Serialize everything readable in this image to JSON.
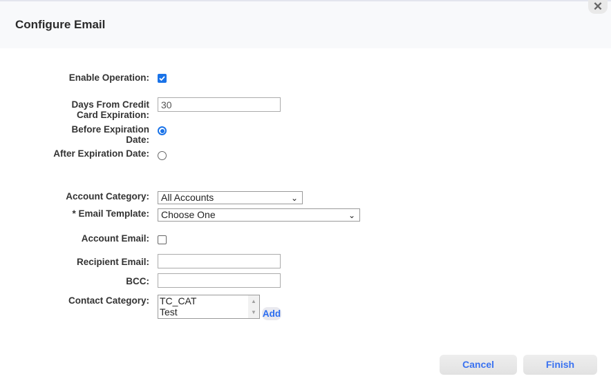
{
  "dialog": {
    "title": "Configure Email",
    "close_icon": "close-icon"
  },
  "form": {
    "enable_operation": {
      "label": "Enable Operation:",
      "checked": true
    },
    "days_from_expiration": {
      "label_line1": "Days From Credit",
      "label_line2": "Card Expiration:",
      "value": "30"
    },
    "before_expiration": {
      "label_line1": "Before Expiration",
      "label_line2": "Date:",
      "selected": true
    },
    "after_expiration": {
      "label": "After Expiration Date:",
      "selected": false
    },
    "account_category": {
      "label": "Account Category:",
      "value": "All Accounts"
    },
    "email_template": {
      "label": "* Email Template:",
      "value": "Choose One"
    },
    "account_email": {
      "label": "Account Email:",
      "checked": false
    },
    "recipient_email": {
      "label": "Recipient Email:",
      "value": ""
    },
    "bcc": {
      "label": "BCC:",
      "value": ""
    },
    "contact_category": {
      "label": "Contact Category:",
      "options": [
        "TC_CAT",
        "Test"
      ],
      "add_label": "Add"
    }
  },
  "footer": {
    "cancel_label": "Cancel",
    "finish_label": "Finish"
  },
  "colors": {
    "accent": "#1a73e8",
    "button_text": "#3a72f0"
  }
}
